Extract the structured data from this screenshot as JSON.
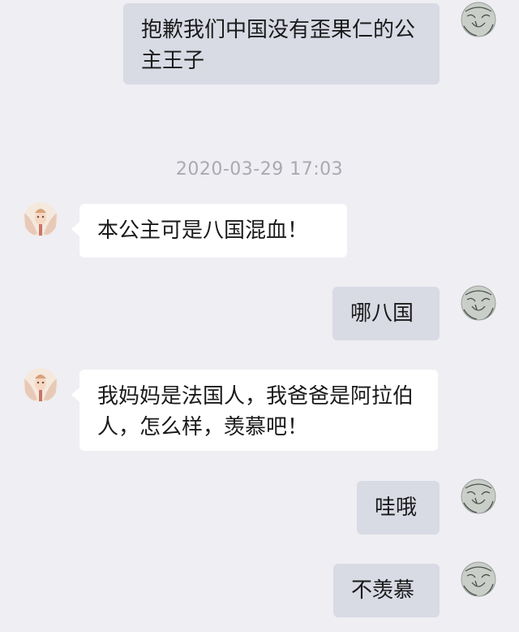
{
  "conversation": {
    "timestamp": "2020-03-29 17:03",
    "messages": [
      {
        "side": "right",
        "text": "抱歉我们中国没有歪果仁的公主王子"
      },
      {
        "side": "left",
        "text": "本公主可是八国混血！"
      },
      {
        "side": "right",
        "text": "哪八国"
      },
      {
        "side": "left",
        "text": "我妈妈是法国人，我爸爸是阿拉伯人，怎么样，羡慕吧！"
      },
      {
        "side": "right",
        "text": "哇哦"
      },
      {
        "side": "right",
        "text": "不羡慕"
      }
    ]
  },
  "avatars": {
    "self": "sketch-face-avatar",
    "contact": "character-portrait-avatar"
  },
  "colors": {
    "background": "#eeeef3",
    "right_bubble": "#d8dae4",
    "left_bubble": "#ffffff",
    "timestamp_text": "#a9a9b0"
  }
}
